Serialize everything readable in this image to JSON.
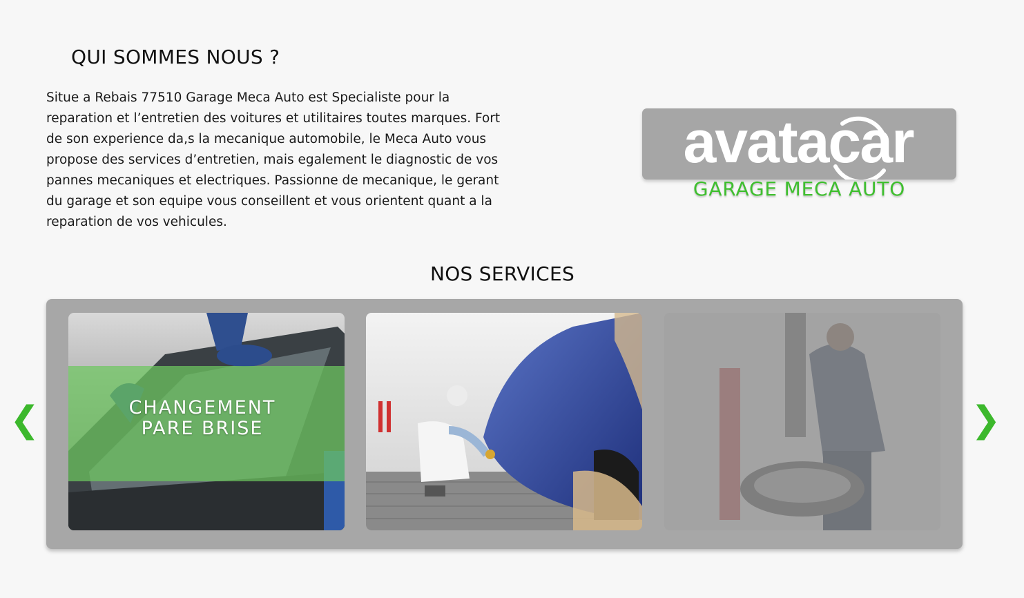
{
  "about": {
    "title": "QUI SOMMES NOUS ?",
    "text": "Situe a Rebais 77510 Garage Meca Auto est Specialiste pour la reparation et l’entretien des voitures et utilitaires toutes marques. Fort de son experience da,s la mecanique automobile, le Meca Auto vous propose des services d’entretien, mais egalement le diagnostic de vos pannes mecaniques et electriques. Passionne de mecanique, le gerant du garage et son equipe vous conseillent et vous orientent quant a la reparation de vos vehicules."
  },
  "logo": {
    "wordmark": "avatacar",
    "subtitle": "GARAGE MECA AUTO",
    "accent_color": "#3fbf2f",
    "box_color": "#a6a6a6"
  },
  "services": {
    "title": "NOS SERVICES",
    "prev_icon": "chevron-left-icon",
    "next_icon": "chevron-right-icon",
    "prev_glyph": "❮",
    "next_glyph": "❯",
    "cards": [
      {
        "caption_line1": "CHANGEMENT",
        "caption_line2": "PARE BRISE",
        "image": "windshield-replacement-photo"
      },
      {
        "image": "car-body-painting-photo"
      },
      {
        "image": "tire-changing-mechanic-photo"
      }
    ]
  }
}
